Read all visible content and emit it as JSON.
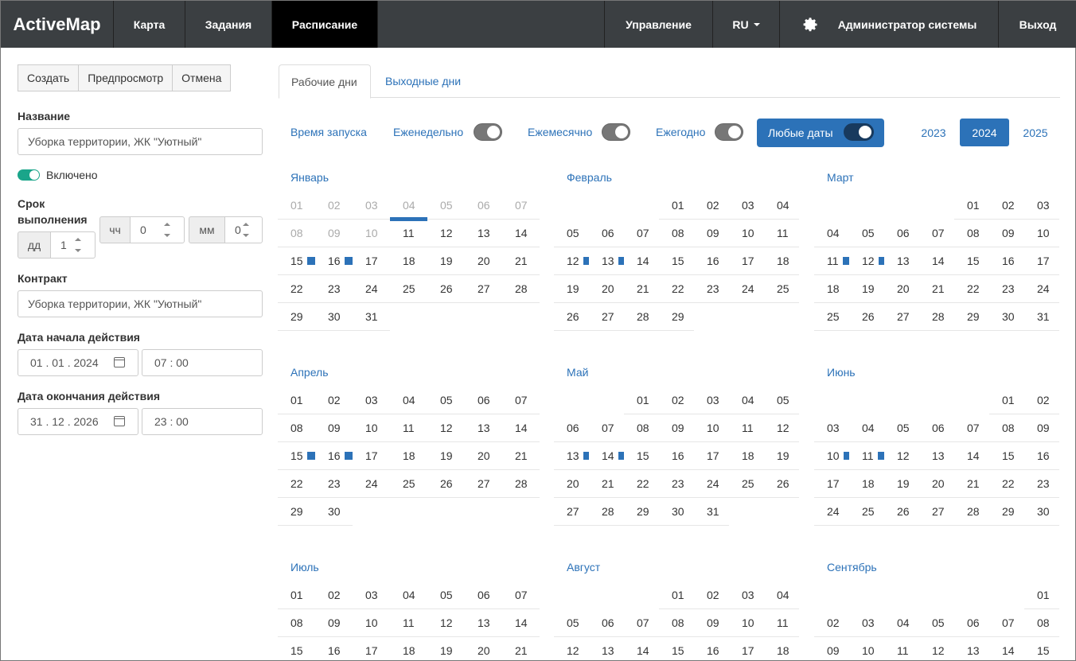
{
  "nav": {
    "brand": "ActiveMap",
    "left_items": [
      "Карта",
      "Задания",
      "Расписание"
    ],
    "active": "Расписание",
    "right_items": {
      "manage": "Управление",
      "lang": "RU",
      "user": "Администратор системы",
      "logout": "Выход"
    }
  },
  "toolbar": {
    "create": "Создать",
    "preview": "Предпросмотр",
    "cancel": "Отмена"
  },
  "form": {
    "name_label": "Название",
    "name_value": "Уборка территории, ЖК \"Уютный\"",
    "enabled_label": "Включено",
    "enabled": true,
    "duration_label_1": "Срок",
    "duration_label_2": "выполнения",
    "hh_addon": "чч",
    "hh_value": "0",
    "mm_addon": "мм",
    "mm_value": "0",
    "dd_addon": "дд",
    "dd_value": "1",
    "contract_label": "Контракт",
    "contract_value": "Уборка территории, ЖК \"Уютный\"",
    "start_label": "Дата начала действия",
    "start_date": "01 . 01 . 2024",
    "start_time": "07 : 00",
    "end_label": "Дата окончания действия",
    "end_date": "31 . 12 . 2026",
    "end_time": "23 : 00"
  },
  "tabs": {
    "workdays": "Рабочие дни",
    "weekends": "Выходные дни",
    "active": "workdays"
  },
  "options": {
    "start_time": "Время запуска",
    "weekly": "Еженедельно",
    "monthly": "Ежемесячно",
    "yearly": "Ежегодно",
    "any_dates": "Любые даты"
  },
  "years": [
    "2023",
    "2024",
    "2025"
  ],
  "selected_year": "2024",
  "colors": {
    "accent": "#2c72b8",
    "nav": "#3b3f42",
    "toggle_on": "#1aa58a"
  },
  "calendar": {
    "months": [
      {
        "name": "Январь",
        "offset": 0,
        "days": 31,
        "dim_before": 4,
        "today": 4,
        "marked": [
          15,
          16
        ]
      },
      {
        "name": "Февраль",
        "offset": 3,
        "days": 29,
        "marked": [
          12,
          13
        ]
      },
      {
        "name": "Март",
        "offset": 4,
        "days": 31,
        "marked": [
          11,
          12
        ]
      },
      {
        "name": "Апрель",
        "offset": 0,
        "days": 30,
        "marked": [
          15,
          16
        ]
      },
      {
        "name": "Май",
        "offset": 2,
        "days": 31,
        "marked": [
          13,
          14
        ]
      },
      {
        "name": "Июнь",
        "offset": 5,
        "days": 30,
        "marked": [
          10,
          11
        ]
      },
      {
        "name": "Июль",
        "offset": 0,
        "days": 21,
        "marked": []
      },
      {
        "name": "Август",
        "offset": 3,
        "days": 18,
        "marked": []
      },
      {
        "name": "Сентябрь",
        "offset": 6,
        "days": 15,
        "marked": []
      }
    ]
  }
}
